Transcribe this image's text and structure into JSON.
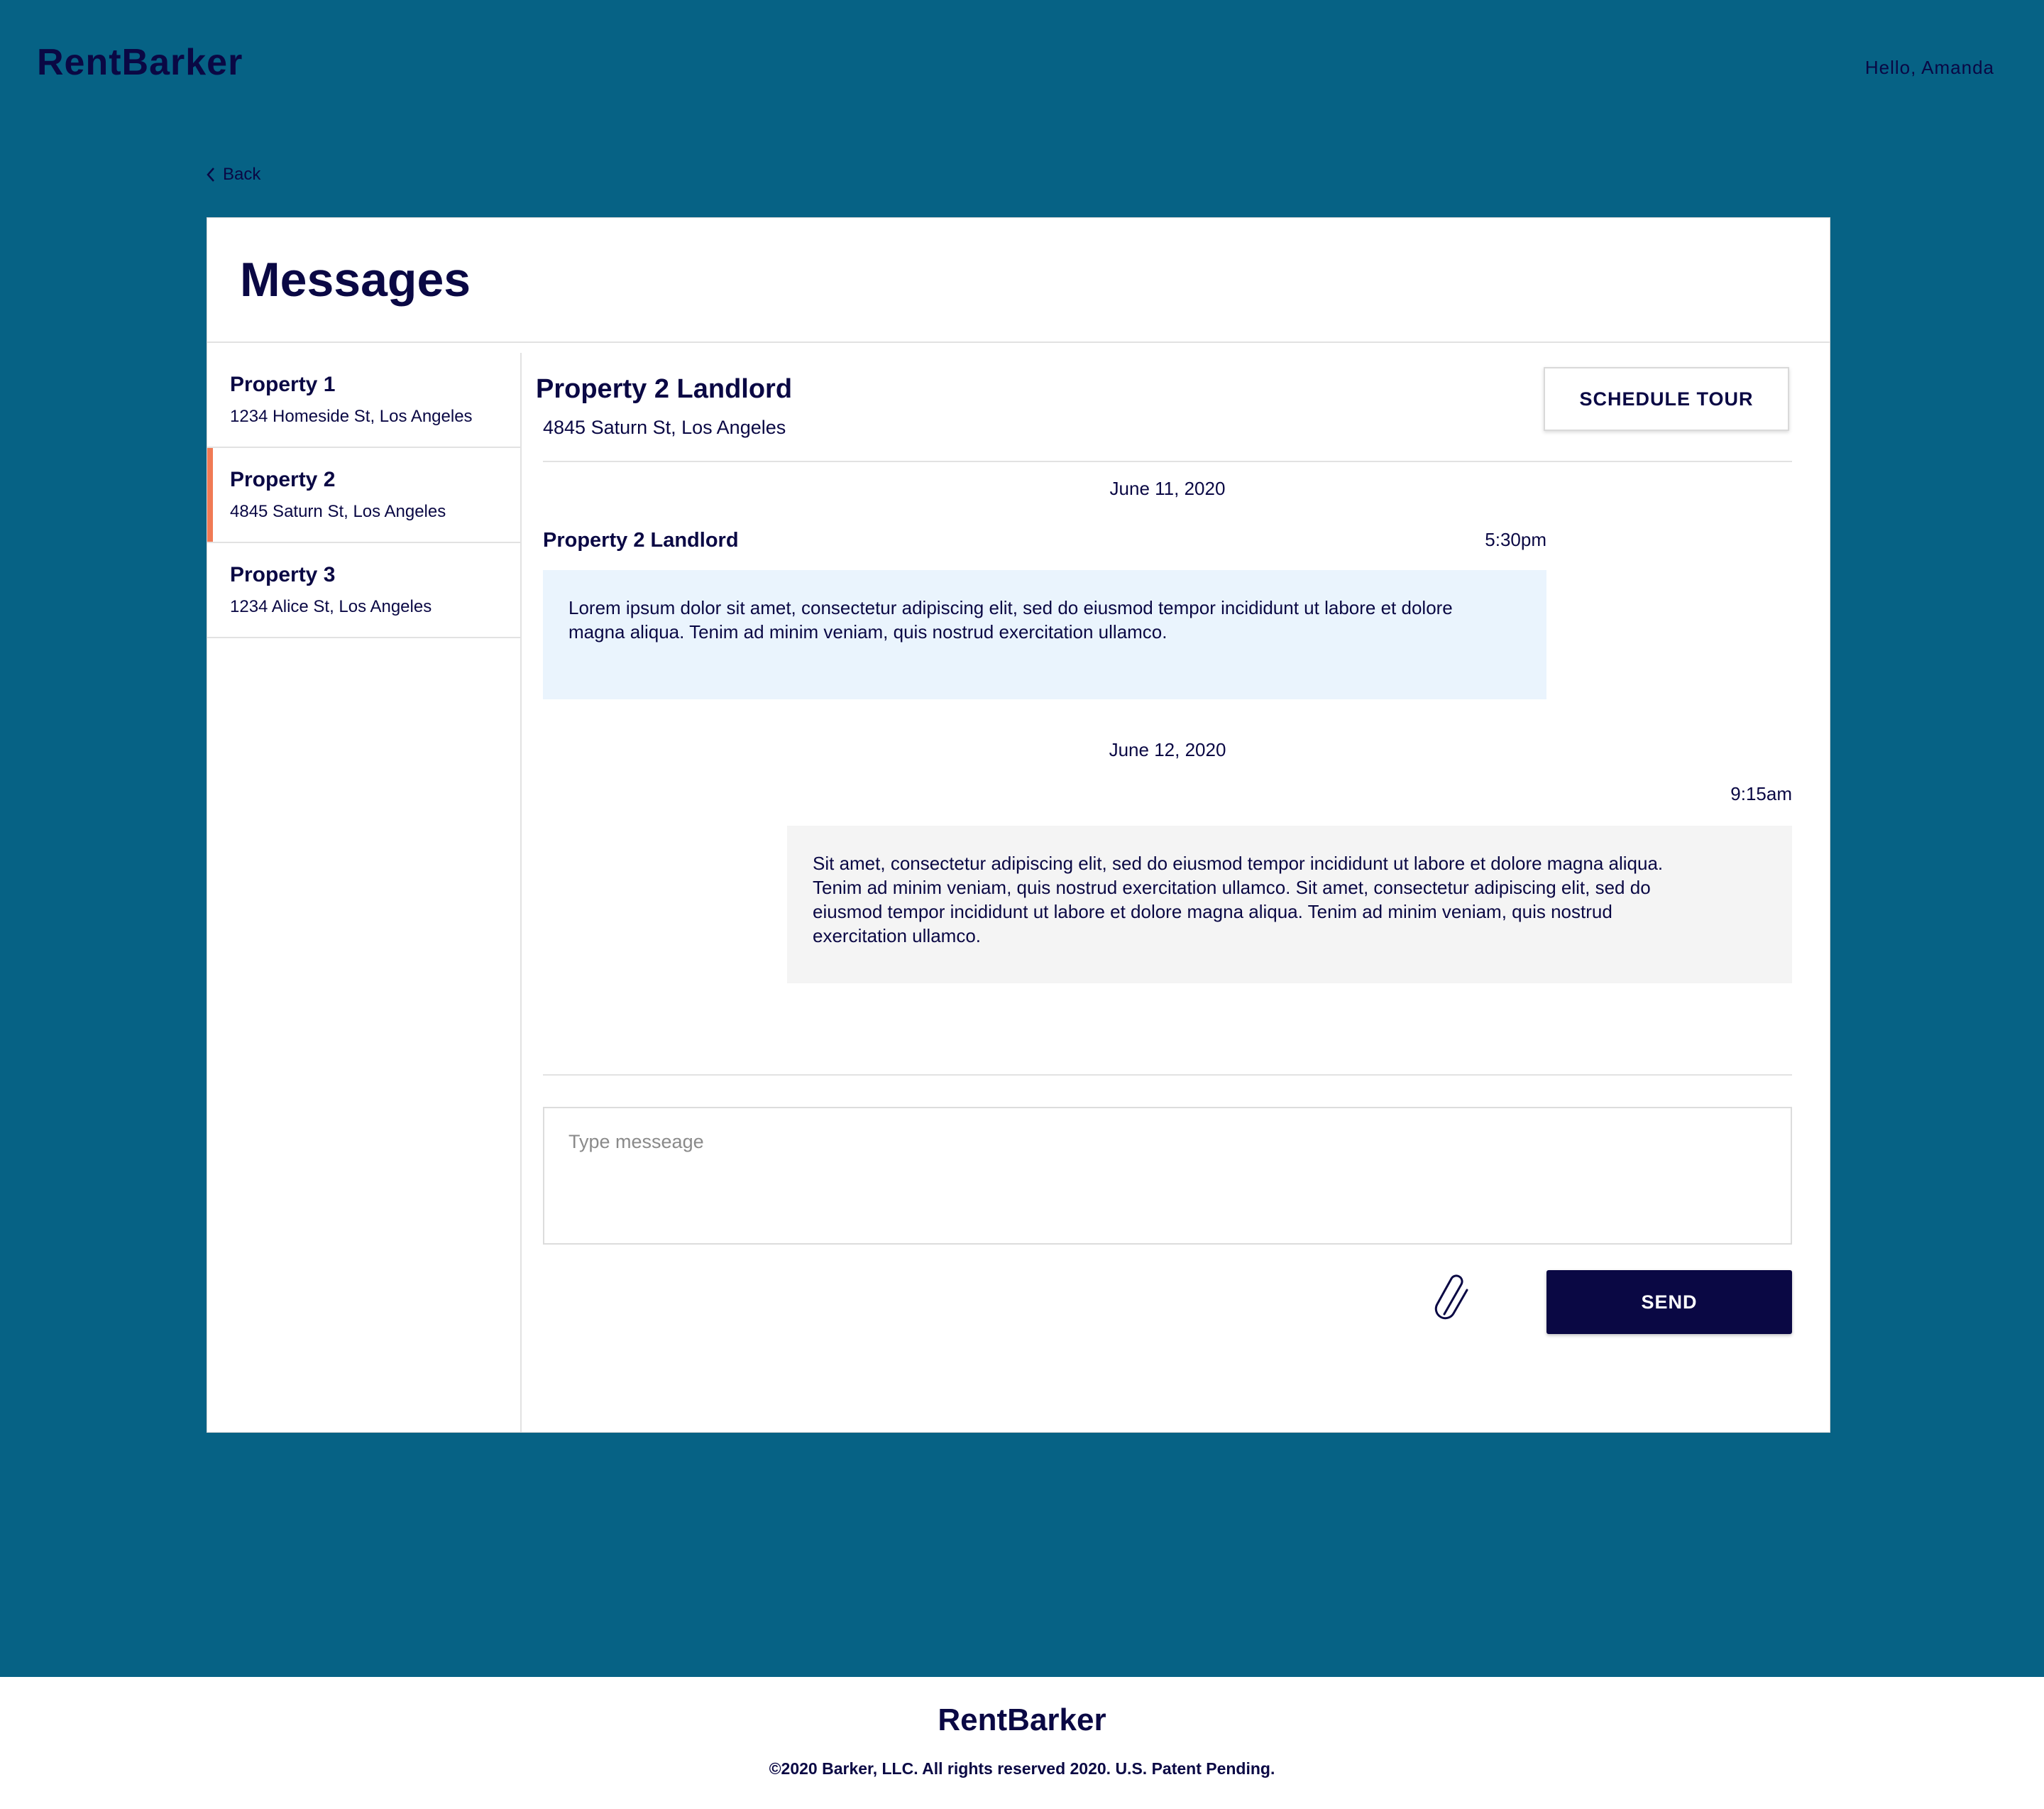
{
  "brand": {
    "name": "RentBarker"
  },
  "header": {
    "greeting": "Hello, Amanda"
  },
  "nav": {
    "back_label": "Back"
  },
  "page": {
    "title": "Messages"
  },
  "sidebar": {
    "items": [
      {
        "name": "Property 1",
        "address": "1234 Homeside St, Los Angeles",
        "active": false
      },
      {
        "name": "Property 2",
        "address": "4845 Saturn St, Los Angeles",
        "active": true
      },
      {
        "name": "Property 3",
        "address": "1234 Alice St, Los Angeles",
        "active": false
      }
    ]
  },
  "thread": {
    "contact_name": "Property 2 Landlord",
    "contact_address": "4845 Saturn St, Los Angeles",
    "schedule_label": "SCHEDULE TOUR",
    "messages": [
      {
        "date": "June 11, 2020",
        "sender": "Property 2 Landlord",
        "time": "5:30pm",
        "text": "Lorem ipsum dolor sit amet, consectetur adipiscing elit, sed do eiusmod tempor incididunt ut labore et dolore magna aliqua. Tenim ad minim veniam, quis nostrud exercitation ullamco.",
        "direction": "incoming"
      },
      {
        "date": "June 12, 2020",
        "sender": "",
        "time": "9:15am",
        "text": "Sit amet, consectetur adipiscing elit, sed do eiusmod tempor incididunt ut labore et dolore magna aliqua. Tenim ad minim veniam, quis nostrud exercitation ullamco. Sit amet, consectetur adipiscing elit, sed do eiusmod tempor incididunt ut labore et dolore magna aliqua. Tenim ad minim veniam, quis nostrud exercitation ullamco.",
        "direction": "outgoing"
      }
    ]
  },
  "composer": {
    "placeholder": "Type messeage",
    "value": "",
    "attach_icon": "paperclip-icon",
    "send_label": "SEND"
  },
  "footer": {
    "brand": "RentBarker",
    "copyright": "©2020 Barker, LLC. All rights reserved 2020. U.S. Patent Pending."
  },
  "colors": {
    "background": "#066285",
    "primary": "#0a0844",
    "accent": "#f07a55",
    "incoming_bubble": "#eaf4fd",
    "outgoing_bubble": "#f4f4f4"
  }
}
